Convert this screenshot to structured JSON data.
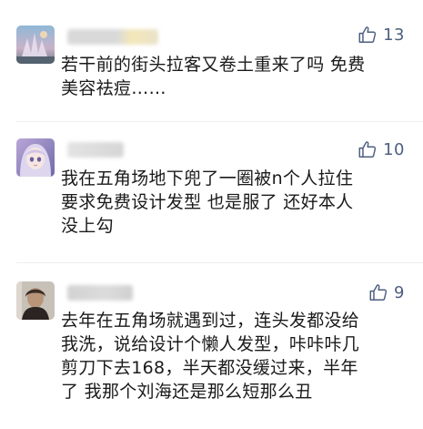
{
  "comments": [
    {
      "likes": "13",
      "text": "若干前的街头拉客又卷土重来了吗 免费\n美容祛痘……"
    },
    {
      "likes": "10",
      "text": "我在五角场地下兜了一圈被n个人拉住\n要求免费设计发型 也是服了 还好本人\n没上勾"
    },
    {
      "likes": "9",
      "text": "去年在五角场就遇到过，连头发都没给\n我洗，说给设计个懒人发型，咔咔咔几\n剪刀下去168，半天都没缓过来，半年\n了 我那个刘海还是那么短那么丑"
    }
  ],
  "icons": {
    "like": "thumbs-up-outline-icon"
  },
  "colors": {
    "text": "#1a1a1a",
    "like_count": "#4d5f7f",
    "like_icon": "#4d5f7f"
  }
}
